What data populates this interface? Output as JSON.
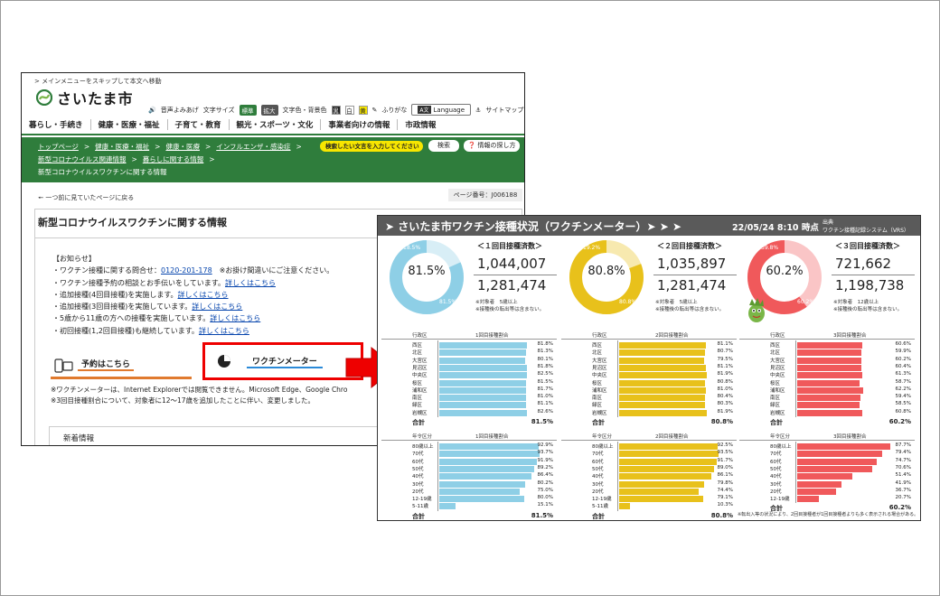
{
  "site": {
    "skip_link": "> メインメニューをスキップして本文へ移動",
    "logo_text": "さいたま市",
    "util": {
      "voice": "音声よみあげ",
      "text_size": "文字サイズ",
      "size_std": "標準",
      "size_big": "拡大",
      "color": "文字色・背景色",
      "color_black": "黒",
      "color_white": "白",
      "color_yellow": "黄",
      "furigana": "ふりがな",
      "language": "Language",
      "language_badge": "A文",
      "sitemap": "サイトマップ"
    },
    "nav": [
      "暮らし・手続き",
      "健康・医療・福祉",
      "子育て・教育",
      "観光・スポーツ・文化",
      "事業者向けの情報",
      "市政情報"
    ],
    "breadcrumb_row1": [
      "トップページ",
      "健康・医療・福祉",
      "健康・医療",
      "インフルエンザ・感染症"
    ],
    "breadcrumb_row2": [
      "新型コロナウイルス関連情報",
      "暮らしに関する情報"
    ],
    "breadcrumb_current": "新型コロナウイルスワクチンに関する情報",
    "search_placeholder": "検索したい文言を入力してください",
    "search_button": "検索",
    "help_button": "情報の探し方",
    "back_link": "一つ前に見ていたページに戻る",
    "page_number": "ページ番号：J006188",
    "page_title": "新型コロナウイルスワクチンに関する情報",
    "notice_head": "【お知らせ】",
    "notice_items": [
      {
        "text": "・ワクチン接種に関する問合せ：",
        "link": "0120-201-178",
        "after": "　※お掛け間違いにご注意ください。"
      },
      {
        "text": "・ワクチン接種予約の相談とお手伝いをしています。",
        "link": "詳しくはこちら",
        "after": ""
      },
      {
        "text": "・追加接種(4回目接種)を実施します。",
        "link": "詳しくはこちら",
        "after": ""
      },
      {
        "text": "・追加接種(3回目接種)を実施しています。",
        "link": "詳しくはこちら",
        "after": ""
      },
      {
        "text": "・5歳から11歳の方への接種を実施しています。",
        "link": "詳しくはこちら",
        "after": ""
      },
      {
        "text": "・初回接種(1,2回目接種)も継続しています。",
        "link": "詳しくはこちら",
        "after": ""
      }
    ],
    "reserve_button": "予約はこちら",
    "meter_button": "ワクチンメーター",
    "note1": "※ワクチンメーターは、Internet Explorerでは閲覧できません。Microsoft Edge、Google Chro",
    "note2": "※3回目接種割合について、対象者に12～17歳を追加したことに伴い、変更しました。",
    "news_title": "新着情報"
  },
  "dashboard": {
    "title": "➤ さいたま市ワクチン接種状況（ワクチンメーター）➤ ➤ ➤",
    "date": "22/05/24 8:10 時点",
    "source_label": "出典",
    "source": "ワクチン接種記録システム（VRS）",
    "colors": {
      "first": "#8ecfe6",
      "second": "#e8c11b",
      "third": "#f0595b"
    },
    "columns": [
      {
        "head": "＜１回目接種済数＞",
        "pct": "81.5%",
        "small_a": "18.5%",
        "small_b": "81.5%",
        "count": "1,044,007",
        "target": "1,281,474",
        "note1": "※対象者　5歳以上",
        "note2": "※接種後の転出等は含まない。",
        "ward_col": "行政区",
        "ward_head": "1回目接種割合",
        "age_col": "年令区分",
        "age_head": "1回目接種割合",
        "total_label": "合計",
        "ward_total": "81.5%",
        "age_total": "81.5%"
      },
      {
        "head": "＜２回目接種済数＞",
        "pct": "80.8%",
        "small_a": "19.2%",
        "small_b": "80.8%",
        "count": "1,035,897",
        "target": "1,281,474",
        "note1": "※対象者　5歳以上",
        "note2": "※接種後の転出等は含まない。",
        "ward_col": "行政区",
        "ward_head": "2回目接種割合",
        "age_col": "年令区分",
        "age_head": "2回目接種割合",
        "total_label": "合計",
        "ward_total": "80.8%",
        "age_total": "80.8%"
      },
      {
        "head": "＜３回目接種済数＞",
        "pct": "60.2%",
        "small_a": "39.8%",
        "small_b": "60.2%",
        "count": "721,662",
        "target": "1,198,738",
        "note1": "※対象者　12歳以上",
        "note2": "※接種後の転出等は含まない。",
        "ward_col": "行政区",
        "ward_head": "3回目接種割合",
        "age_col": "年令区分",
        "age_head": "3回目接種割合",
        "total_label": "合計",
        "ward_total": "60.2%",
        "age_total": "60.2%"
      }
    ],
    "foot_note": "※転出入等の状況により、2回目接種者が1回目接種者よりも多く表示される場合がある。"
  },
  "chart_data": [
    {
      "type": "bar",
      "title": "1回目接種割合",
      "categories": [
        "西区",
        "北区",
        "大宮区",
        "見沼区",
        "中央区",
        "桜区",
        "浦和区",
        "南区",
        "緑区",
        "岩槻区"
      ],
      "values": [
        81.8,
        81.3,
        80.1,
        81.8,
        82.5,
        81.5,
        81.7,
        81.0,
        81.1,
        82.6
      ],
      "xlim": [
        0,
        100
      ]
    },
    {
      "type": "bar",
      "title": "2回目接種割合",
      "categories": [
        "西区",
        "北区",
        "大宮区",
        "見沼区",
        "中央区",
        "桜区",
        "浦和区",
        "南区",
        "緑区",
        "岩槻区"
      ],
      "values": [
        81.1,
        80.7,
        79.5,
        81.1,
        81.9,
        80.8,
        81.0,
        80.4,
        80.3,
        81.9
      ],
      "xlim": [
        0,
        100
      ]
    },
    {
      "type": "bar",
      "title": "3回目接種割合",
      "categories": [
        "西区",
        "北区",
        "大宮区",
        "見沼区",
        "中央区",
        "桜区",
        "浦和区",
        "南区",
        "緑区",
        "岩槻区"
      ],
      "values": [
        60.6,
        59.9,
        60.2,
        60.4,
        61.3,
        58.7,
        62.2,
        59.4,
        58.5,
        60.8
      ],
      "xlim": [
        0,
        100
      ]
    },
    {
      "type": "bar",
      "title": "1回目接種割合",
      "categories": [
        "80歳以上",
        "70代",
        "60代",
        "50代",
        "40代",
        "30代",
        "20代",
        "12-19歳",
        "5-11歳"
      ],
      "values": [
        92.9,
        93.7,
        91.9,
        89.2,
        86.4,
        80.2,
        75.0,
        80.0,
        15.1
      ],
      "xlim": [
        0,
        100
      ]
    },
    {
      "type": "bar",
      "title": "2回目接種割合",
      "categories": [
        "80歳以上",
        "70代",
        "60代",
        "50代",
        "40代",
        "30代",
        "20代",
        "12-19歳",
        "5-11歳"
      ],
      "values": [
        92.5,
        93.5,
        91.7,
        89.0,
        86.1,
        79.8,
        74.4,
        79.1,
        10.3
      ],
      "xlim": [
        0,
        100
      ]
    },
    {
      "type": "bar",
      "title": "3回目接種割合",
      "categories": [
        "80歳以上",
        "70代",
        "60代",
        "50代",
        "40代",
        "30代",
        "20代",
        "12-19歳"
      ],
      "values": [
        87.7,
        79.4,
        74.7,
        70.6,
        51.4,
        41.9,
        36.7,
        20.7
      ],
      "xlim": [
        0,
        100
      ]
    }
  ]
}
